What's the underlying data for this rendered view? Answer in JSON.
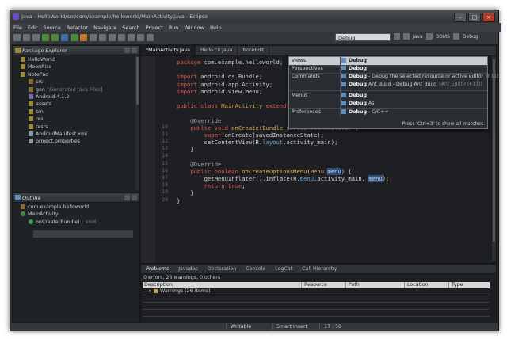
{
  "window": {
    "title": "Java - HelloWorld/src/com/example/helloworld/MainActivity.java - Eclipse",
    "controls": [
      "–",
      "□",
      "×"
    ]
  },
  "menu": [
    "File",
    "Edit",
    "Source",
    "Refactor",
    "Navigate",
    "Search",
    "Project",
    "Run",
    "Window",
    "Help"
  ],
  "toolbar": {
    "quick_access_value": "Debug",
    "perspectives": [
      "Java",
      "DDMS",
      "Debug"
    ]
  },
  "package_explorer": {
    "title": "Package Explorer",
    "nodes": [
      {
        "label": "HelloWorld",
        "note": "",
        "indent": 0,
        "icon": "folder"
      },
      {
        "label": "MoonRise",
        "note": "",
        "indent": 0,
        "icon": "folder"
      },
      {
        "label": "NotePad",
        "note": "",
        "indent": 0,
        "icon": "folder"
      },
      {
        "label": "src",
        "note": "",
        "indent": 1,
        "icon": "pkg"
      },
      {
        "label": "gen",
        "note": "[Generated Java Files]",
        "indent": 1,
        "icon": "pkg"
      },
      {
        "label": "Android 4.1.2",
        "note": "",
        "indent": 1,
        "icon": "lib"
      },
      {
        "label": "assets",
        "note": "",
        "indent": 1,
        "icon": "folder"
      },
      {
        "label": "bin",
        "note": "",
        "indent": 1,
        "icon": "folder"
      },
      {
        "label": "res",
        "note": "",
        "indent": 1,
        "icon": "folder"
      },
      {
        "label": "tests",
        "note": "",
        "indent": 1,
        "icon": "folder"
      },
      {
        "label": "AndroidManifest.xml",
        "note": "",
        "indent": 1,
        "icon": "file"
      },
      {
        "label": "project.properties",
        "note": "",
        "indent": 1,
        "icon": "file"
      }
    ]
  },
  "outline": {
    "title": "Outline",
    "nodes": [
      {
        "label": "com.example.helloworld",
        "note": "",
        "indent": 0,
        "icon": "pkg"
      },
      {
        "label": "MainActivity",
        "note": "",
        "indent": 0,
        "icon": "cls"
      },
      {
        "label": "onCreate(Bundle)",
        "note": ": void",
        "indent": 1,
        "icon": "meth"
      }
    ]
  },
  "editor": {
    "tabs": [
      "*MainActivity.java",
      "Hello.cir.java",
      "NoteEdit"
    ],
    "lines": [
      {
        "n": "",
        "html": "<span class='kw'>package</span> <span class='pk'>com.example.helloworld;</span>"
      },
      {
        "n": "",
        "html": ""
      },
      {
        "n": "",
        "html": "<span class='kw'>import</span> <span class='pk'>android.os.Bundle;</span>"
      },
      {
        "n": "",
        "html": "<span class='kw'>import</span> <span class='pk'>android.app.Activity;</span>"
      },
      {
        "n": "",
        "html": "<span class='kw'>import</span> <span class='pk'>android.view.Menu;</span>"
      },
      {
        "n": "",
        "html": ""
      },
      {
        "n": "",
        "html": "<span class='kw'>public class</span> <span class='ty'>MainActivity</span> <span class='kw'>extends</span> <span class='ty'>Acti</span>"
      },
      {
        "n": "",
        "html": ""
      },
      {
        "n": "",
        "html": "    <span class='an'>@Override</span>"
      },
      {
        "n": "10",
        "html": "    <span class='kw'>public void</span> <span class='fn'>onCreate</span>(<span class='ty'>Bundle</span> savedInstanceState) {"
      },
      {
        "n": "11",
        "html": "        <span class='kw'>super</span>.onCreate(savedInstanceState);"
      },
      {
        "n": "12",
        "html": "        setContentView(R.<span class='fld'>layout</span>.activity_main);"
      },
      {
        "n": "13",
        "html": "    }"
      },
      {
        "n": "14",
        "html": ""
      },
      {
        "n": "15",
        "html": "    <span class='an'>@Override</span>"
      },
      {
        "n": "16",
        "html": "    <span class='kw'>public boolean</span> <span class='fn'>onCreateOptionsMenu</span>(<span class='ty'>Menu</span> <span class='hl'>menu</span>) {"
      },
      {
        "n": "17",
        "html": "        getMenuInflater().inflate(R.<span class='fld'>menu</span>.activity_main, <span class='hl'>menu</span>);"
      },
      {
        "n": "18",
        "html": "        <span class='kw'>return true</span>;"
      },
      {
        "n": "19",
        "html": "    }"
      },
      {
        "n": "20",
        "html": "}"
      }
    ]
  },
  "quick_access": {
    "rows": [
      {
        "category": "Views",
        "item_bold": "Debug",
        "item_rest": ""
      },
      {
        "category": "Perspectives",
        "item_bold": "Debug",
        "item_rest": ""
      },
      {
        "category": "Commands",
        "item_bold": "Debug",
        "item_rest": " - Debug the selected resource or active editor",
        "dim": "(F11)"
      },
      {
        "category": "",
        "item_bold": "Debug",
        "item_rest": " Ant Build - Debug Ant Build",
        "dim": "(Ant Editor (F11))"
      },
      {
        "category": "Menus",
        "item_bold": "Debug",
        "item_rest": ""
      },
      {
        "category": "",
        "item_bold": "Debug",
        "item_rest": " As",
        "dim": ""
      },
      {
        "category": "Preferences",
        "item_bold": "Debug",
        "item_rest": " - C/C++",
        "dim": ""
      }
    ],
    "footer": "Press 'Ctrl+3' to show all matches."
  },
  "problems": {
    "tabs": [
      "Problems",
      "Javadoc",
      "Declaration",
      "Console",
      "LogCat",
      "Call Hierarchy"
    ],
    "summary": "0 errors, 26 warnings, 0 others",
    "columns": [
      "Description",
      "Resource",
      "Path",
      "Location",
      "Type"
    ],
    "rows": [
      "Warnings (26 items)"
    ]
  },
  "status": {
    "writable": "Writable",
    "insert_mode": "Smart Insert",
    "position": "17 : 58"
  },
  "colors": {
    "accent": "#e0574f",
    "window_bg": "#2b2e31"
  }
}
